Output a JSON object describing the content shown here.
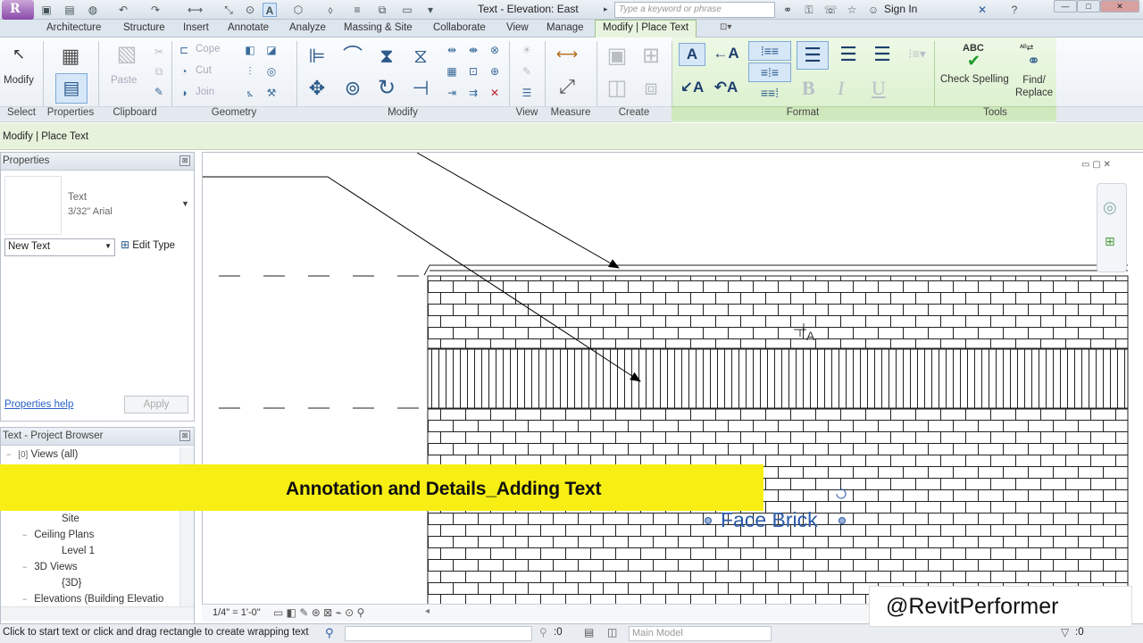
{
  "titlebar": {
    "doc_title": "Text - Elevation: East",
    "search_placeholder": "Type a keyword or phrase",
    "sign_in": "Sign In"
  },
  "tabs": [
    "Architecture",
    "Structure",
    "Insert",
    "Annotate",
    "Analyze",
    "Massing & Site",
    "Collaborate",
    "View",
    "Manage"
  ],
  "active_tab": "Modify | Place Text",
  "ribbon": {
    "modify_label": "Modify",
    "paste_label": "Paste",
    "cope_label": "Cope",
    "cut_label": "Cut",
    "join_label": "Join",
    "check_spelling_label": "Check Spelling",
    "find_replace_label": "Find/ Replace",
    "abc": "ABC",
    "panels": {
      "select": "Select",
      "properties": "Properties",
      "clipboard": "Clipboard",
      "geometry": "Geometry",
      "modify": "Modify",
      "view": "View",
      "measure": "Measure",
      "create": "Create",
      "format": "Format",
      "tools": "Tools"
    }
  },
  "options_bar": {
    "label": "Modify | Place Text"
  },
  "properties": {
    "title": "Properties",
    "type_name": "Text",
    "type_sub": "3/32\" Arial",
    "filter": "New Text",
    "edit_type": "Edit Type",
    "help": "Properties help",
    "apply": "Apply"
  },
  "browser": {
    "title": "Text - Project Browser",
    "items": [
      {
        "label": "Views (all)",
        "expander": "−"
      },
      {
        "label": "Site",
        "expander": ""
      },
      {
        "label": "Ceiling Plans",
        "expander": "−"
      },
      {
        "label": "Level 1",
        "expander": ""
      },
      {
        "label": "3D Views",
        "expander": "−"
      },
      {
        "label": "{3D}",
        "expander": ""
      },
      {
        "label": "Elevations (Building Elevatio",
        "expander": "−"
      }
    ]
  },
  "canvas": {
    "annotation_text": "Face Brick",
    "cursor_label": "A"
  },
  "view_control": {
    "scale": "1/4\" = 1'-0\""
  },
  "statusbar": {
    "message": "Click to start text or click and drag rectangle to create wrapping text",
    "zero": ":0",
    "model": "Main Model",
    "filter_count": ":0"
  },
  "overlays": {
    "banner": "Annotation and Details_Adding  Text",
    "watermark": "@RevitPerformer"
  },
  "colors": {
    "banner": "#f7ef14",
    "context_tab": "#e8f4df",
    "annotation": "#2a5aa8"
  }
}
